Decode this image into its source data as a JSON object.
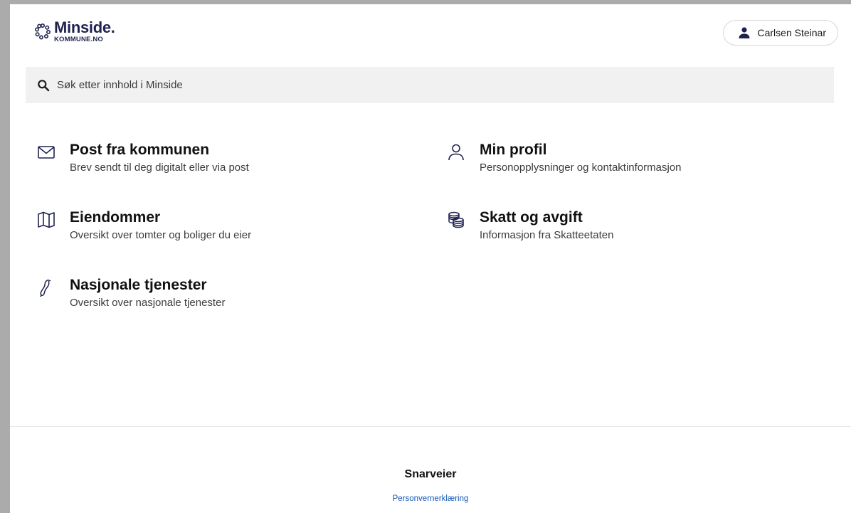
{
  "header": {
    "logo_name": "Minside.",
    "logo_sub": "KOMMUNE.NO",
    "user_name": "Carlsen Steinar"
  },
  "search": {
    "placeholder": "Søk etter innhold i Minside"
  },
  "tiles": [
    {
      "icon": "envelope-icon",
      "title": "Post fra kommunen",
      "description": "Brev sendt til deg digitalt eller via post"
    },
    {
      "icon": "person-icon",
      "title": "Min profil",
      "description": "Personopplysninger og kontaktinformasjon"
    },
    {
      "icon": "map-icon",
      "title": "Eiendommer",
      "description": "Oversikt over tomter og boliger du eier"
    },
    {
      "icon": "coins-icon",
      "title": "Skatt og avgift",
      "description": "Informasjon fra Skatteetaten"
    },
    {
      "icon": "nasjonale-icon",
      "title": "Nasjonale tjenester",
      "description": "Oversikt over nasjonale tjenester"
    }
  ],
  "footer": {
    "title": "Snarveier",
    "link": "Personvernerklæring"
  },
  "colors": {
    "brand": "#1f2250",
    "link": "#1558b8",
    "search_bg": "#f1f1f2"
  }
}
